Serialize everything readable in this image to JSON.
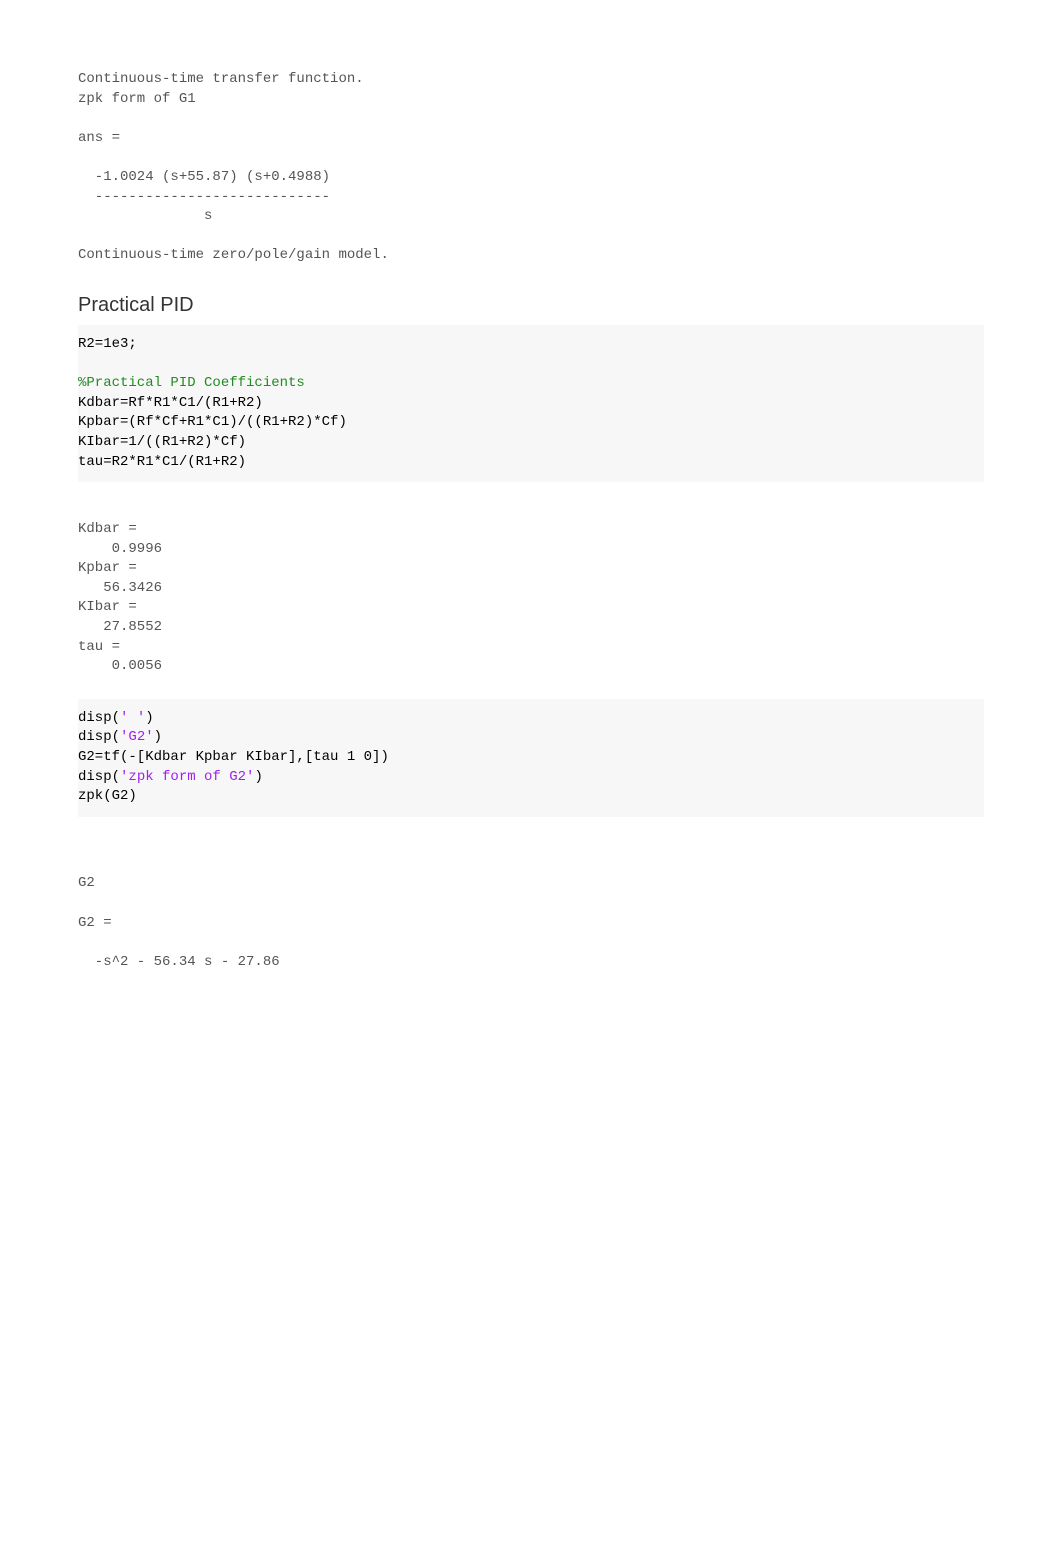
{
  "out1": {
    "cttf": "Continuous-time transfer function.",
    "zpkform": "zpk form of G1",
    "blank1": "",
    "ans": "ans =",
    "blank2": "",
    "num": "  -1.0024 (s+55.87) (s+0.4988)",
    "dash": "  ----------------------------",
    "den": "               s",
    "blank3": "",
    "ctzpk": "Continuous-time zero/pole/gain model."
  },
  "heading1": "Practical PID",
  "code1": {
    "l1": "R2=1e3;",
    "blank1": "",
    "c1": "%Practical PID Coefficients",
    "l2": "Kdbar=Rf*R1*C1/(R1+R2)",
    "l3": "Kpbar=(Rf*Cf+R1*C1)/((R1+R2)*Cf)",
    "l4": "KIbar=1/((R1+R2)*Cf)",
    "l5": "tau=R2*R1*C1/(R1+R2)"
  },
  "out2": {
    "l1": "Kdbar =",
    "l2": "    0.9996",
    "l3": "Kpbar =",
    "l4": "   56.3426",
    "l5": "KIbar =",
    "l6": "   27.8552",
    "l7": "tau =",
    "l8": "    0.0056"
  },
  "code2": {
    "l1a": "disp(",
    "s1": "' '",
    "l1b": ")",
    "l2a": "disp(",
    "s2": "'G2'",
    "l2b": ")",
    "l3": "G2=tf(-[Kdbar Kpbar KIbar],[tau 1 0])",
    "l4a": "disp(",
    "s4": "'zpk form of G2'",
    "l4b": ")",
    "l5": "zpk(G2)"
  },
  "out3": {
    "blank0": "",
    "l1": "G2",
    "blank1": "",
    "l2": "G2 =",
    "blank2": "",
    "l3": "  -s^2 - 56.34 s - 27.86"
  }
}
